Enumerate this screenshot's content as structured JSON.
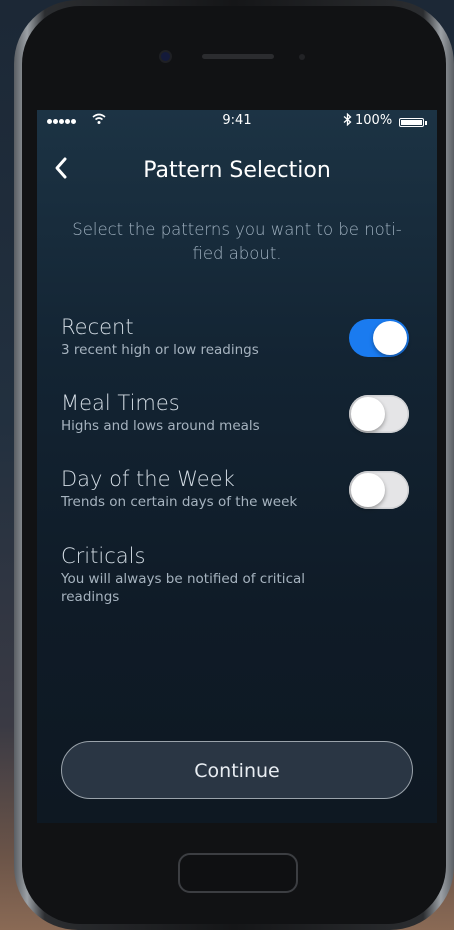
{
  "status_bar": {
    "time": "9:41",
    "battery_percent": "100%",
    "signal_icon": "signal-dots-icon",
    "wifi_icon": "wifi-icon",
    "bluetooth_icon": "bluetooth-icon",
    "battery_icon": "battery-icon"
  },
  "nav": {
    "title": "Pattern Selection",
    "back_icon": "chevron-left-icon"
  },
  "subtitle": "Select the patterns you want to be noti-fied about.",
  "patterns": [
    {
      "title": "Recent",
      "description": "3 recent high or low readings",
      "enabled": true
    },
    {
      "title": "Meal Times",
      "description": "Highs and lows around meals",
      "enabled": false
    },
    {
      "title": "Day of the Week",
      "description": "Trends on certain days of the week",
      "enabled": false
    },
    {
      "title": "Criticals",
      "description": "You will always be notified of critical readings"
    }
  ],
  "continue_label": "Continue",
  "colors": {
    "accent": "#1a7bf0",
    "screen_bg": "#132433",
    "text_primary": "#d4dde5",
    "text_secondary": "#a6b3bf"
  }
}
